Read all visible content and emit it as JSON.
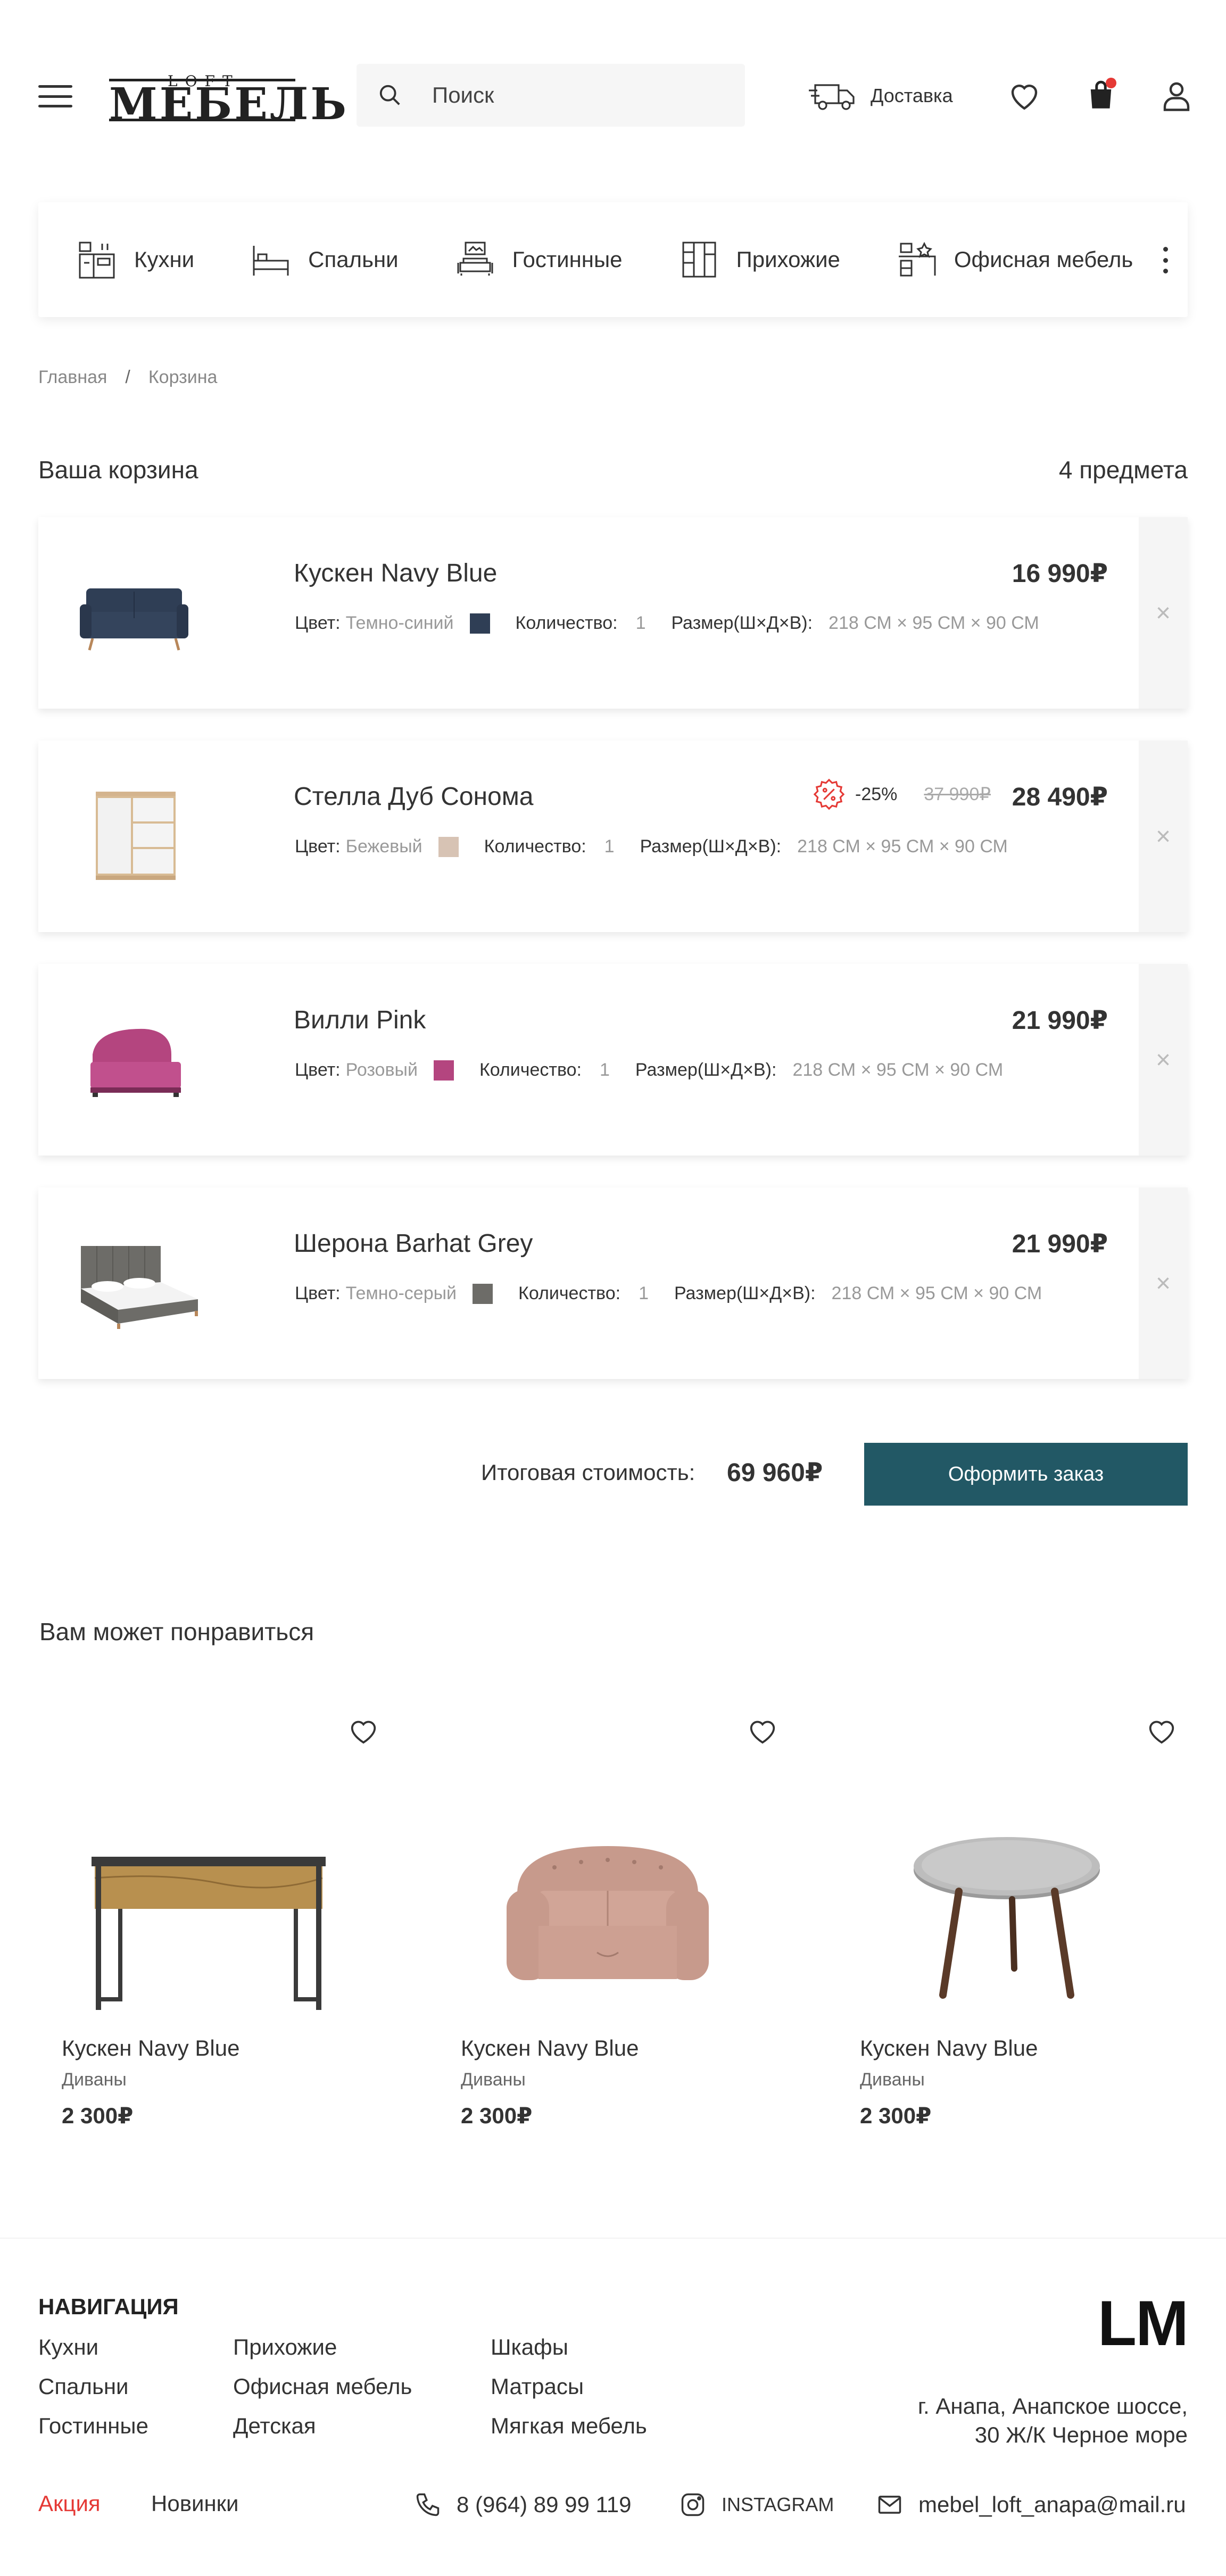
{
  "header": {
    "logo_small": "LOFT",
    "logo_big": "МЕБЕЛЬ",
    "search_placeholder": "Поиск",
    "delivery_label": "Доставка",
    "accent_color": "#225865",
    "notification_color": "#e53935"
  },
  "categories": [
    {
      "label": "Кухни",
      "icon": "kitchen-icon"
    },
    {
      "label": "Спальни",
      "icon": "bed-icon"
    },
    {
      "label": "Гостинные",
      "icon": "sofa-icon"
    },
    {
      "label": "Прихожие",
      "icon": "wardrobe-icon"
    },
    {
      "label": "Офисная мебель",
      "icon": "office-icon"
    }
  ],
  "breadcrumb": [
    "Главная",
    "/",
    "Корзина"
  ],
  "cart": {
    "title": "Ваша корзина",
    "count": "4 предмета",
    "labels": {
      "color": "Цвет:",
      "quantity": "Количество:",
      "size": "Размер(Ш×Д×В):"
    },
    "items": [
      {
        "name": "Кускен Navy Blue",
        "price": "16 990₽",
        "color_name": "Темно-синий",
        "swatch": "#2f3e55",
        "qty": "1",
        "size": "218 СМ  ×  95 СМ  ×  90 СМ"
      },
      {
        "name": "Стелла Дуб Сонома",
        "price": "28 490₽",
        "old_price": "37 990₽",
        "discount": "-25%",
        "color_name": "Бежевый",
        "swatch": "#d7c3b4",
        "qty": "1",
        "size": "218 СМ  ×  95 СМ  ×  90 СМ"
      },
      {
        "name": "Вилли Pink",
        "price": "21 990₽",
        "color_name": "Розовый",
        "swatch": "#b4457f",
        "qty": "1",
        "size": "218 СМ  ×  95 СМ  ×  90 СМ"
      },
      {
        "name": "Шерона Barhat Grey",
        "price": "21 990₽",
        "color_name": "Темно-серый",
        "swatch": "#6d6c68",
        "qty": "1",
        "size": "218 СМ  ×  95 СМ  ×  90 СМ"
      }
    ],
    "remove_glyph": "×",
    "total_label": "Итоговая стоимость:",
    "total_value": "69 960₽",
    "checkout_label": "Оформить заказ"
  },
  "recommendations": {
    "title": "Вам может понравиться",
    "items": [
      {
        "name": "Кускен Navy Blue",
        "category": "Диваны",
        "price": "2 300₽"
      },
      {
        "name": "Кускен Navy Blue",
        "category": "Диваны",
        "price": "2 300₽"
      },
      {
        "name": "Кускен Navy Blue",
        "category": "Диваны",
        "price": "2 300₽"
      }
    ]
  },
  "footer": {
    "nav_title": "НАВИГАЦИЯ",
    "nav_col1": [
      "Кухни",
      "Спальни",
      "Гостинные"
    ],
    "nav_col2": [
      "Прихожие",
      "Офисная мебель",
      "Детская"
    ],
    "nav_col3": [
      "Шкафы",
      "Матрасы",
      "Мягкая мебель"
    ],
    "promo": "Акция",
    "news": "Новинки",
    "phone": "8 (964) 89 99 119",
    "instagram": "INSTAGRAM",
    "email": "mebel_loft_anapa@mail.ru",
    "brand": "LM",
    "address_line1": "г. Анапа, Анапское шоссе,",
    "address_line2": "30 Ж/К Черное море"
  }
}
